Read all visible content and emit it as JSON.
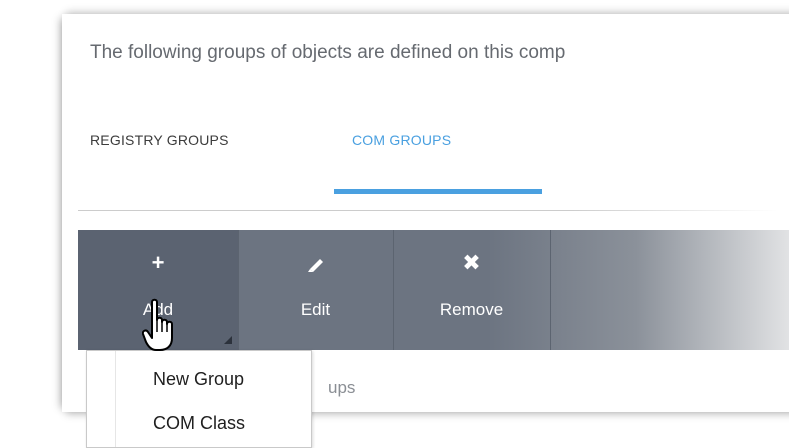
{
  "intro_text": "The following groups of objects are defined on this comp",
  "tabs": [
    {
      "label": "REGISTRY GROUPS",
      "active": false
    },
    {
      "label": "COM GROUPS",
      "active": true
    }
  ],
  "toolbar": {
    "add": {
      "icon": "plus-icon",
      "label": "Add"
    },
    "edit": {
      "icon": "pencil-icon",
      "label": "Edit"
    },
    "remove": {
      "icon": "x-icon",
      "label": "Remove"
    }
  },
  "list_partial_text": "ups",
  "dropdown_menu": {
    "items": [
      "New Group",
      "COM Class"
    ]
  },
  "colors": {
    "accent": "#4aa0e0",
    "toolbar": "#6c7481",
    "toolbar_active": "#5b6371"
  }
}
